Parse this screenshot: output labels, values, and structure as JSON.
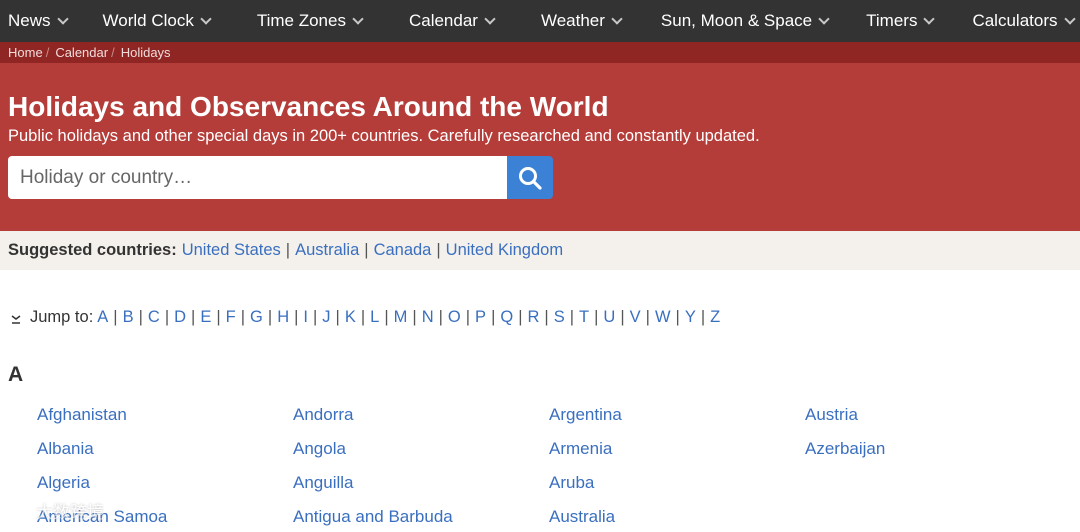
{
  "nav": {
    "items": [
      {
        "label": "News"
      },
      {
        "label": "World Clock"
      },
      {
        "label": "Time Zones"
      },
      {
        "label": "Calendar"
      },
      {
        "label": "Weather"
      },
      {
        "label": "Sun, Moon & Space"
      },
      {
        "label": "Timers"
      },
      {
        "label": "Calculators"
      }
    ]
  },
  "breadcrumb": {
    "items": [
      "Home",
      "Calendar",
      "Holidays"
    ],
    "separator": "/"
  },
  "hero": {
    "title": "Holidays and Observances Around the World",
    "subtitle": "Public holidays and other special days in 200+ countries. Carefully researched and constantly updated.",
    "search_placeholder": "Holiday or country…"
  },
  "suggested": {
    "label": "Suggested countries:",
    "countries": [
      "United States",
      "Australia",
      "Canada",
      "United Kingdom"
    ]
  },
  "jump": {
    "label": "Jump to:",
    "letters": [
      "A",
      "B",
      "C",
      "D",
      "E",
      "F",
      "G",
      "H",
      "I",
      "J",
      "K",
      "L",
      "M",
      "N",
      "O",
      "P",
      "Q",
      "R",
      "S",
      "T",
      "U",
      "V",
      "W",
      "Y",
      "Z"
    ]
  },
  "section": {
    "letter": "A",
    "columns": [
      [
        "Afghanistan",
        "Albania",
        "Algeria",
        "American Samoa"
      ],
      [
        "Andorra",
        "Angola",
        "Anguilla",
        "Antigua and Barbuda"
      ],
      [
        "Argentina",
        "Armenia",
        "Aruba",
        "Australia"
      ],
      [
        "Austria",
        "Azerbaijan"
      ]
    ]
  },
  "watermark": {
    "text": "大数跨境"
  },
  "colors": {
    "nav_bg": "#333333",
    "breadcrumb_bg": "#8f2623",
    "hero_bg": "#b43d39",
    "search_button": "#3b82d6",
    "suggested_bg": "#f4f1ec",
    "link": "#3a6fbf"
  },
  "icons": {
    "nav_dropdown": "chevron-down-icon",
    "search": "search-icon",
    "jump": "double-chevron-down-icon"
  }
}
